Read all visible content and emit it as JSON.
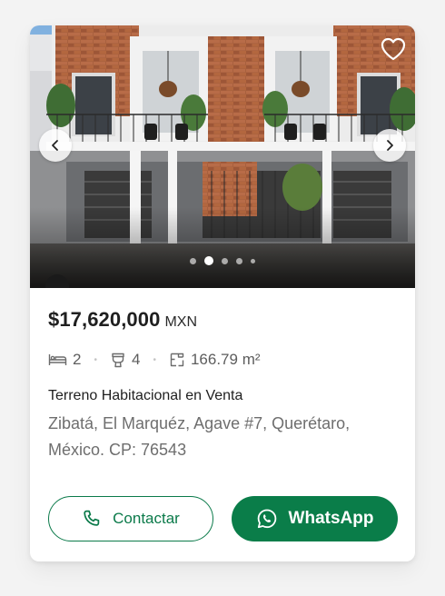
{
  "listing": {
    "price": "$17,620,000",
    "currency": "MXN",
    "bedrooms": "2",
    "bathrooms": "4",
    "area": "166.79 m²",
    "property_type": "Terreno Habitacional en Venta",
    "address": "Zibatá, El Marquéz, Agave  #7, Querétaro, México. CP: 76543"
  },
  "gallery": {
    "dot_count": 5,
    "active_index": 1
  },
  "icons": {
    "favorite": "heart-icon",
    "previous": "chevron-left-icon",
    "next": "chevron-right-icon",
    "bedrooms": "bed-icon",
    "bathrooms": "toilet-icon",
    "area": "floor-plan-icon",
    "contact": "phone-icon",
    "whatsapp": "whatsapp-icon"
  },
  "actions": {
    "contact_label": "Contactar",
    "whatsapp_label": "WhatsApp"
  },
  "colors": {
    "brand_green": "#0a7d49",
    "price_text": "#1f1f1f",
    "muted_text": "#6e6e6e"
  }
}
